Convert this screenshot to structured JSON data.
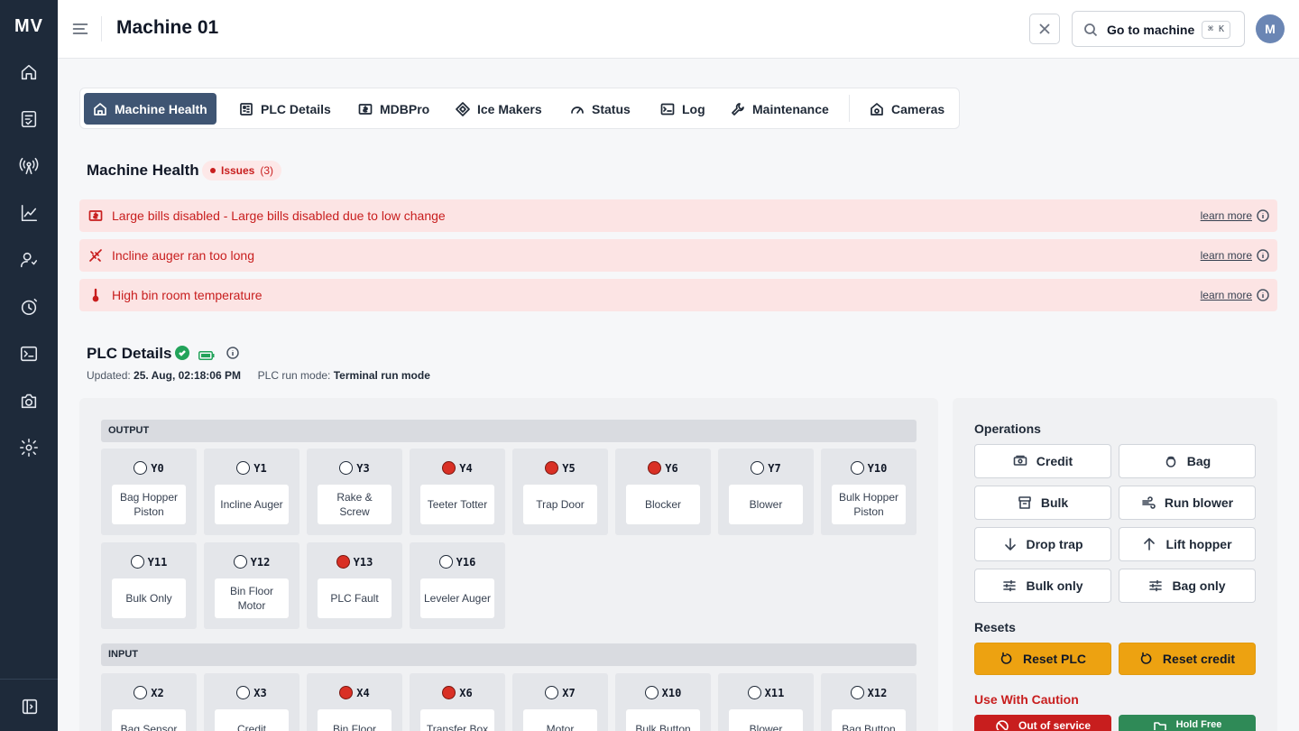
{
  "app": {
    "logo": "MV"
  },
  "header": {
    "title": "Machine 01",
    "search_label": "Go to machine",
    "shortcut": "⌘ K",
    "avatar_initial": "M"
  },
  "tabs": [
    {
      "label": "Machine Health",
      "icon": "home-icon"
    },
    {
      "label": "PLC Details",
      "icon": "plc-icon"
    },
    {
      "label": "MDBPro",
      "icon": "bill-icon"
    },
    {
      "label": "Ice Makers",
      "icon": "diamond-icon"
    },
    {
      "label": "Status",
      "icon": "gauge-icon"
    },
    {
      "label": "Log",
      "icon": "terminal-icon"
    },
    {
      "label": "Maintenance",
      "icon": "wrench-icon"
    },
    {
      "label": "Cameras",
      "icon": "camera-home-icon"
    }
  ],
  "health": {
    "title": "Machine Health",
    "issues_label": "Issues",
    "issues_count": "(3)",
    "alerts": [
      {
        "text": "Large bills disabled - Large bills disabled due to low change",
        "link": "learn more",
        "icon": "bill-icon"
      },
      {
        "text": "Incline auger ran too long",
        "link": "learn more",
        "icon": "auger-icon"
      },
      {
        "text": "High bin room temperature",
        "link": "learn more",
        "icon": "thermometer-icon"
      }
    ]
  },
  "plc": {
    "title": "PLC Details",
    "updated_label": "Updated:",
    "updated_value": "25. Aug, 02:18:06 PM",
    "mode_label": "PLC run mode:",
    "mode_value": "Terminal run mode",
    "output_header": "OUTPUT",
    "input_header": "INPUT",
    "outputs": [
      {
        "code": "Y0",
        "label": "Bag Hopper Piston",
        "on": false
      },
      {
        "code": "Y1",
        "label": "Incline Auger",
        "on": false
      },
      {
        "code": "Y3",
        "label": "Rake & Screw",
        "on": false
      },
      {
        "code": "Y4",
        "label": "Teeter Totter",
        "on": true
      },
      {
        "code": "Y5",
        "label": "Trap Door",
        "on": true
      },
      {
        "code": "Y6",
        "label": "Blocker",
        "on": true
      },
      {
        "code": "Y7",
        "label": "Blower",
        "on": false
      },
      {
        "code": "Y10",
        "label": "Bulk Hopper Piston",
        "on": false
      },
      {
        "code": "Y11",
        "label": "Bulk Only",
        "on": false
      },
      {
        "code": "Y12",
        "label": "Bin Floor Motor",
        "on": false
      },
      {
        "code": "Y13",
        "label": "PLC Fault",
        "on": true
      },
      {
        "code": "Y16",
        "label": "Leveler Auger",
        "on": false
      }
    ],
    "inputs": [
      {
        "code": "X2",
        "label": "Bag Sensor",
        "on": false
      },
      {
        "code": "X3",
        "label": "Credit",
        "on": false
      },
      {
        "code": "X4",
        "label": "Bin Floor",
        "on": true
      },
      {
        "code": "X6",
        "label": "Transfer Box",
        "on": true
      },
      {
        "code": "X7",
        "label": "Motor",
        "on": false
      },
      {
        "code": "X10",
        "label": "Bulk Button",
        "on": false
      },
      {
        "code": "X11",
        "label": "Blower",
        "on": false
      },
      {
        "code": "X12",
        "label": "Bag Button",
        "on": false
      }
    ]
  },
  "operations": {
    "title": "Operations",
    "buttons": [
      {
        "label": "Credit",
        "icon": "cash-icon"
      },
      {
        "label": "Bag",
        "icon": "bag-icon"
      },
      {
        "label": "Bulk",
        "icon": "archive-icon"
      },
      {
        "label": "Run blower",
        "icon": "wind-icon"
      },
      {
        "label": "Drop trap",
        "icon": "arrow-down-icon"
      },
      {
        "label": "Lift hopper",
        "icon": "arrow-up-icon"
      },
      {
        "label": "Bulk only",
        "icon": "sliders-icon"
      },
      {
        "label": "Bag only",
        "icon": "sliders-icon"
      }
    ],
    "resets_title": "Resets",
    "resets": [
      {
        "label": "Reset PLC",
        "icon": "reset-icon"
      },
      {
        "label": "Reset credit",
        "icon": "reset-icon"
      }
    ],
    "caution_title": "Use With Caution",
    "caution": [
      {
        "label": "Out of service",
        "icon": "ban-icon"
      },
      {
        "label": "Hold Free",
        "icon": "folder-icon"
      }
    ]
  },
  "colors": {
    "sidebar": "#1e2a3a",
    "active_tab": "#3f5573",
    "alert_bg": "#fce4e4",
    "alert_text": "#c81e1e",
    "indicator_on": "#d93025",
    "warn": "#eda211",
    "danger": "#c81e1e",
    "ok": "#2f8a57"
  }
}
